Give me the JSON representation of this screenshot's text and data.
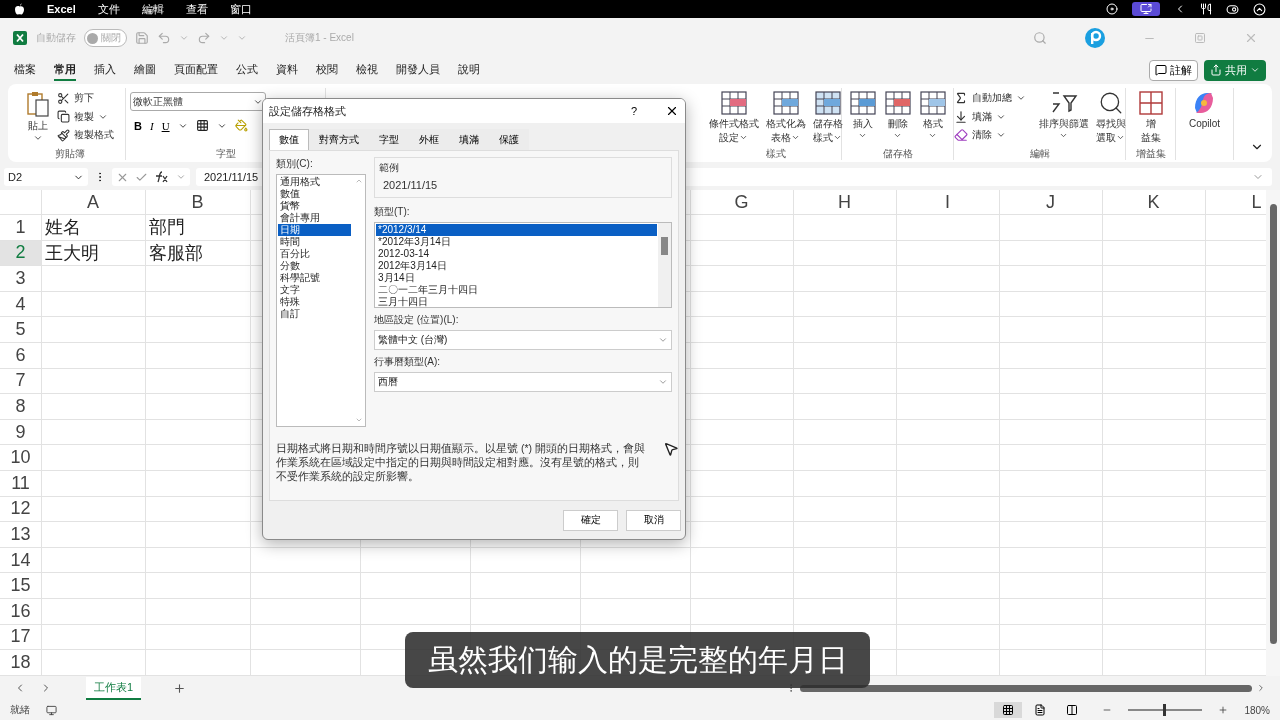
{
  "menu_bar": {
    "items": [
      "Excel",
      "文件",
      "編輯",
      "查看",
      "窗口"
    ]
  },
  "title_bar": {
    "autosave_label": "自動儲存",
    "autosave": {
      "label": "關閉",
      "on": false
    },
    "title": "活頁簿1  -  Excel"
  },
  "tabs": [
    {
      "label": "檔案",
      "selected": false
    },
    {
      "label": "常用",
      "selected": true
    },
    {
      "label": "插入",
      "selected": false
    },
    {
      "label": "繪圖",
      "selected": false
    },
    {
      "label": "頁面配置",
      "selected": false
    },
    {
      "label": "公式",
      "selected": false
    },
    {
      "label": "資料",
      "selected": false
    },
    {
      "label": "校閱",
      "selected": false
    },
    {
      "label": "檢視",
      "selected": false
    },
    {
      "label": "開發人員",
      "selected": false
    },
    {
      "label": "說明",
      "selected": false
    }
  ],
  "comment_button": "註解",
  "share_button": "共用",
  "ribbon": {
    "clipboard": {
      "label": "剪貼簿",
      "paste": "貼上",
      "items": [
        {
          "label": "剪下",
          "menu": false
        },
        {
          "label": "複製",
          "menu": true
        },
        {
          "label": "複製格式",
          "menu": false
        }
      ]
    },
    "font": {
      "label": "字型",
      "font_name": "微軟正黑體",
      "buttons": [
        "B",
        "I",
        "U"
      ]
    },
    "groups": [
      {
        "label": "樣式",
        "buttons": [
          {
            "kind": "large",
            "lines": [
              "條件式格式",
              "設定"
            ],
            "menu": true
          },
          {
            "kind": "large",
            "lines": [
              "格式化為",
              "表格"
            ],
            "menu": true
          },
          {
            "kind": "large",
            "lines": [
              "儲存格",
              "樣式"
            ],
            "menu": true
          }
        ]
      },
      {
        "label": "儲存格",
        "buttons": [
          {
            "kind": "large",
            "lines": [
              "插入"
            ],
            "menu": true
          },
          {
            "kind": "large",
            "lines": [
              "刪除"
            ],
            "menu": true
          },
          {
            "kind": "large",
            "lines": [
              "格式"
            ],
            "menu": true
          }
        ]
      },
      {
        "label": "編輯",
        "buttons": [
          {
            "kind": "small",
            "lines": [
              "自動加總"
            ],
            "menu": true
          },
          {
            "kind": "small",
            "lines": [
              "填滿"
            ],
            "menu": true
          },
          {
            "kind": "small",
            "lines": [
              "清除"
            ],
            "menu": true
          },
          {
            "kind": "large",
            "lines": [
              "排序與篩選"
            ],
            "menu": true
          },
          {
            "kind": "large",
            "lines": [
              "尋找與",
              "選取"
            ],
            "menu": true
          }
        ]
      },
      {
        "label": "增益集",
        "buttons": [
          {
            "kind": "large",
            "lines": [
              "增",
              "益集"
            ],
            "menu": false
          }
        ]
      },
      {
        "buttons": [
          {
            "kind": "large",
            "lines": [
              "Copilot"
            ],
            "menu": false
          }
        ]
      }
    ]
  },
  "formula_bar": {
    "name_box": "D2",
    "formula": "2021/11/15"
  },
  "sheet": {
    "columns": [
      "A",
      "B",
      "G",
      "H",
      "I",
      "J",
      "K",
      "L"
    ],
    "rows": [
      {
        "header": "1",
        "selected": false,
        "cells": [
          "姓名",
          "部門"
        ]
      },
      {
        "header": "2",
        "selected": true,
        "cells": [
          "王大明",
          "客服部"
        ]
      },
      {
        "header": "3",
        "selected": false,
        "cells": []
      },
      {
        "header": "4",
        "selected": false,
        "cells": []
      },
      {
        "header": "5",
        "selected": false,
        "cells": []
      },
      {
        "header": "6",
        "selected": false,
        "cells": []
      },
      {
        "header": "7",
        "selected": false,
        "cells": []
      },
      {
        "header": "8",
        "selected": false,
        "cells": []
      },
      {
        "header": "9",
        "selected": false,
        "cells": []
      },
      {
        "header": "10",
        "selected": false,
        "cells": []
      },
      {
        "header": "11",
        "selected": false,
        "cells": []
      },
      {
        "header": "12",
        "selected": false,
        "cells": []
      },
      {
        "header": "13",
        "selected": false,
        "cells": []
      },
      {
        "header": "14",
        "selected": false,
        "cells": []
      },
      {
        "header": "15",
        "selected": false,
        "cells": []
      },
      {
        "header": "16",
        "selected": false,
        "cells": []
      },
      {
        "header": "17",
        "selected": false,
        "cells": []
      },
      {
        "header": "18",
        "selected": false,
        "cells": []
      }
    ]
  },
  "dialog": {
    "title": "設定儲存格格式",
    "help": "?",
    "tabs": [
      {
        "label": "數值",
        "selected": true
      },
      {
        "label": "對齊方式",
        "selected": false
      },
      {
        "label": "字型",
        "selected": false
      },
      {
        "label": "外框",
        "selected": false
      },
      {
        "label": "填滿",
        "selected": false
      },
      {
        "label": "保護",
        "selected": false
      }
    ],
    "category_label": "類別(C):",
    "categories": [
      {
        "label": "通用格式",
        "selected": false
      },
      {
        "label": "數值",
        "selected": false
      },
      {
        "label": "貨幣",
        "selected": false
      },
      {
        "label": "會計專用",
        "selected": false
      },
      {
        "label": "日期",
        "selected": true
      },
      {
        "label": "時間",
        "selected": false
      },
      {
        "label": "百分比",
        "selected": false
      },
      {
        "label": "分數",
        "selected": false
      },
      {
        "label": "科學記號",
        "selected": false
      },
      {
        "label": "文字",
        "selected": false
      },
      {
        "label": "特殊",
        "selected": false
      },
      {
        "label": "自訂",
        "selected": false
      }
    ],
    "sample_label": "範例",
    "sample": "2021/11/15",
    "type_label": "類型(T):",
    "types": [
      {
        "label": "*2012/3/14",
        "selected": true
      },
      {
        "label": "*2012年3月14日",
        "selected": false
      },
      {
        "label": "2012-03-14",
        "selected": false
      },
      {
        "label": "2012年3月14日",
        "selected": false
      },
      {
        "label": "3月14日",
        "selected": false
      },
      {
        "label": "二〇一二年三月十四日",
        "selected": false
      },
      {
        "label": "三月十四日",
        "selected": false
      }
    ],
    "locale_label": "地區設定 (位置)(L):",
    "locale": "繁體中文 (台灣)",
    "calendar_label": "行事曆類型(A):",
    "calendar": "西曆",
    "description": "日期格式將日期和時間序號以日期值顯示。以星號 (*) 開頭的日期格式，會與作業系統在區域設定中指定的日期與時間設定相對應。沒有星號的格式，則不受作業系統的設定所影響。",
    "ok": "確定",
    "cancel": "取消"
  },
  "sheet_tabs": [
    {
      "label": "工作表1",
      "selected": true
    }
  ],
  "status_bar": {
    "status": "就緒",
    "views": [
      {
        "selected": true
      },
      {
        "selected": false
      },
      {
        "selected": false
      }
    ],
    "zoom": {
      "level": 0.47
    },
    "zoom_label": "180%"
  },
  "subtitle": "虽然我们输入的是完整的年月日"
}
